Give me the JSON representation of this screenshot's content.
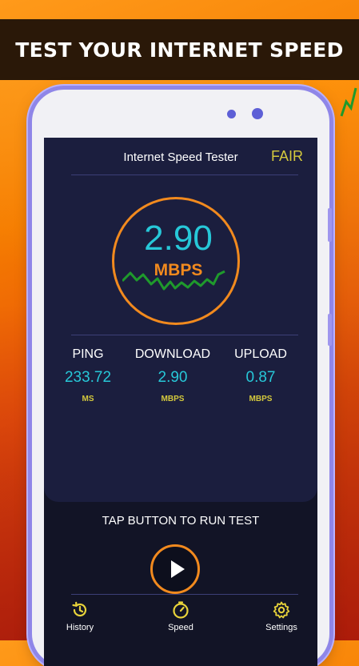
{
  "banner": {
    "title": "TEST YOUR INTERNET SPEED"
  },
  "app": {
    "title": "Internet Speed Tester",
    "status": "FAIR",
    "gauge": {
      "value": "2.90",
      "unit": "MBPS"
    },
    "metrics": [
      {
        "label": "PING",
        "value": "233.72",
        "unit": "MS"
      },
      {
        "label": "DOWNLOAD",
        "value": "2.90",
        "unit": "MBPS"
      },
      {
        "label": "UPLOAD",
        "value": "0.87",
        "unit": "MBPS"
      }
    ],
    "action": {
      "prompt": "TAP BUTTON TO RUN TEST",
      "button_icon": "play-icon"
    }
  },
  "nav": [
    {
      "label": "History",
      "icon": "history-icon"
    },
    {
      "label": "Speed",
      "icon": "speedometer-icon"
    },
    {
      "label": "Settings",
      "icon": "gear-icon"
    }
  ],
  "colors": {
    "accent_orange": "#f28a1e",
    "value_cyan": "#27c8d8",
    "status_yellow": "#d4c93d",
    "graph_green": "#1f9a2c",
    "screen_bg": "#121426",
    "card_bg": "#1b1e3e"
  }
}
